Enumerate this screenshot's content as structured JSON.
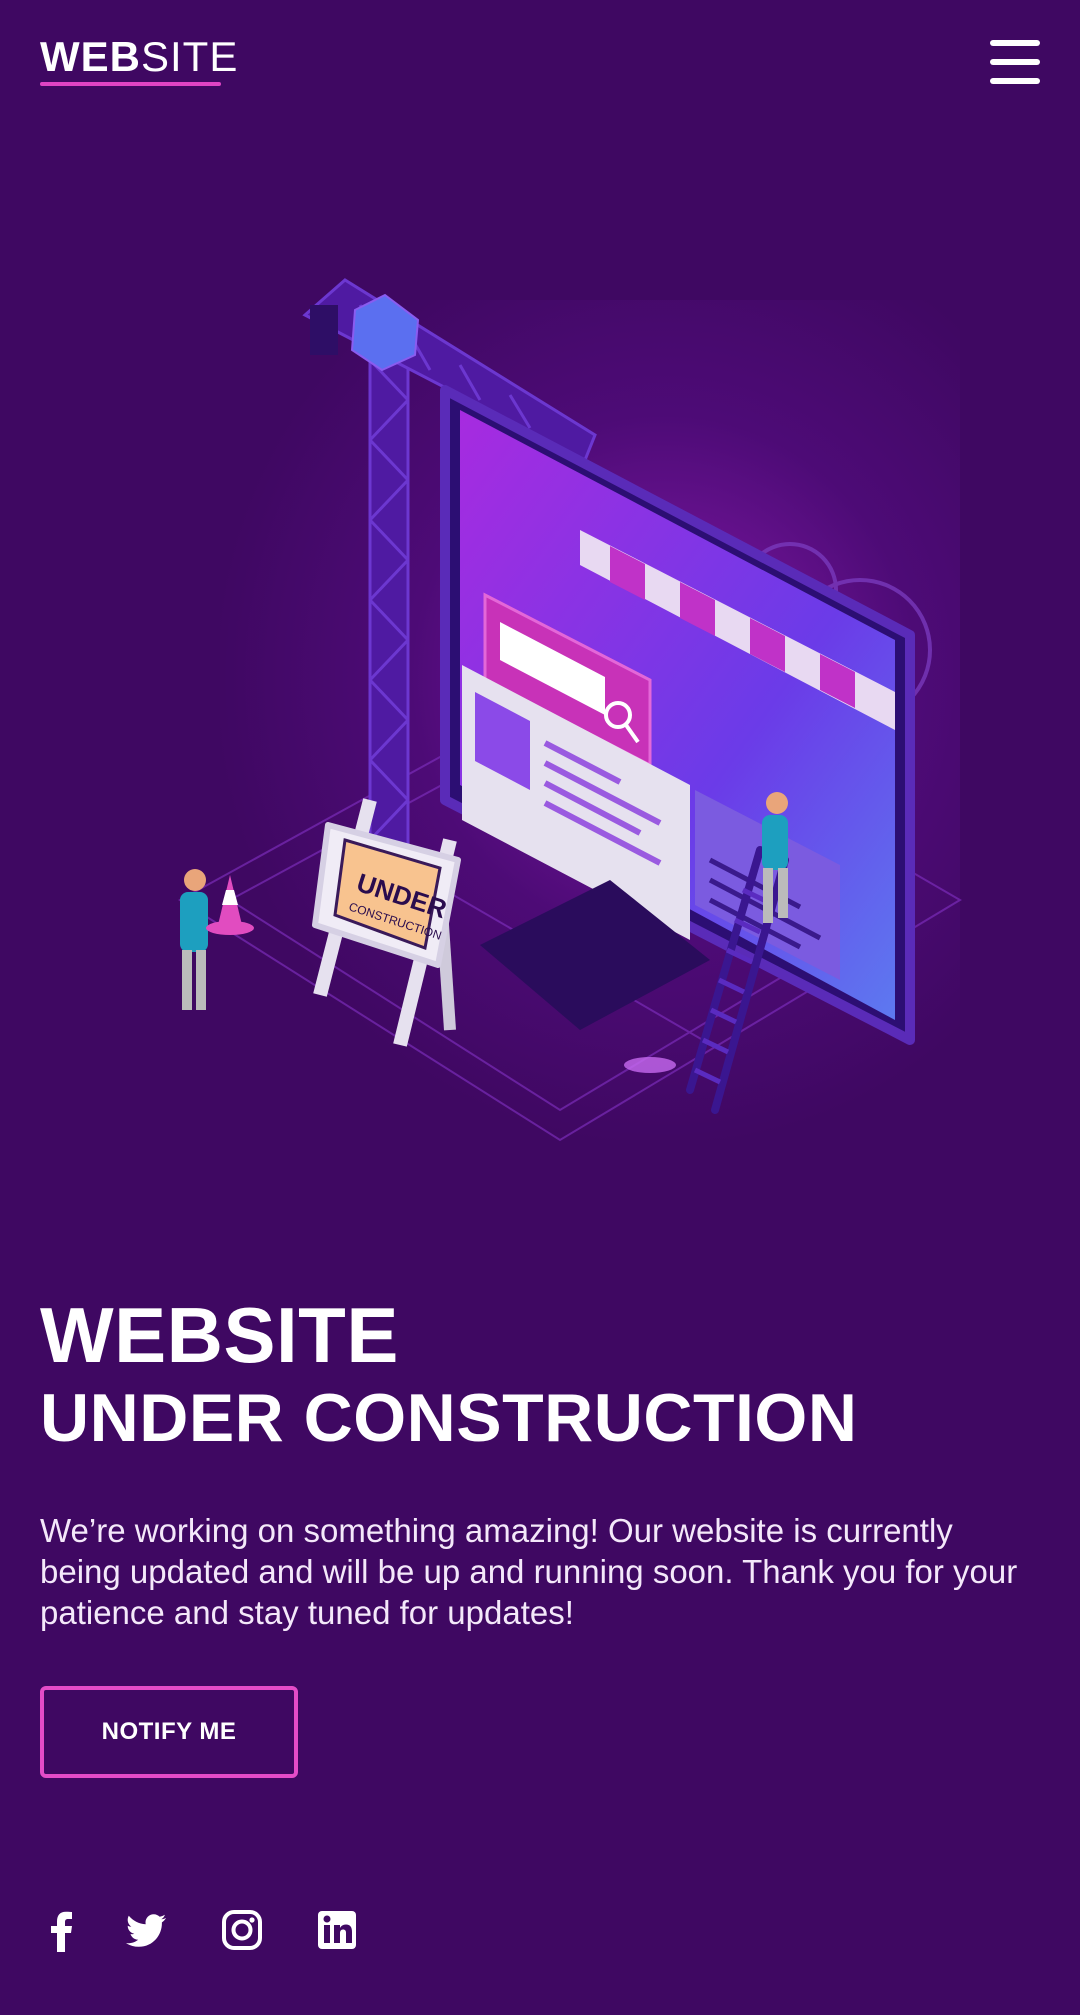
{
  "header": {
    "logo_bold": "WEB",
    "logo_light": "SITE",
    "menu_icon": "hamburger-menu-icon"
  },
  "hero": {
    "illustration": "isometric-under-construction-illustration",
    "sign_line1": "UNDER",
    "sign_line2": "CONSTRUCTION"
  },
  "main": {
    "title_line1": "WEBSITE",
    "title_line2": "UNDER CONSTRUCTION",
    "description": "We’re working on something amazing! Our website is currently being updated and will be up and running soon. Thank you for your patience and stay tuned for updates!",
    "notify_label": "NOTIFY ME"
  },
  "social": [
    {
      "icon": "facebook-icon"
    },
    {
      "icon": "twitter-icon"
    },
    {
      "icon": "instagram-icon"
    },
    {
      "icon": "linkedin-icon"
    }
  ],
  "colors": {
    "background": "#3f0862",
    "accent": "#e044c4",
    "text": "#ffffff"
  }
}
